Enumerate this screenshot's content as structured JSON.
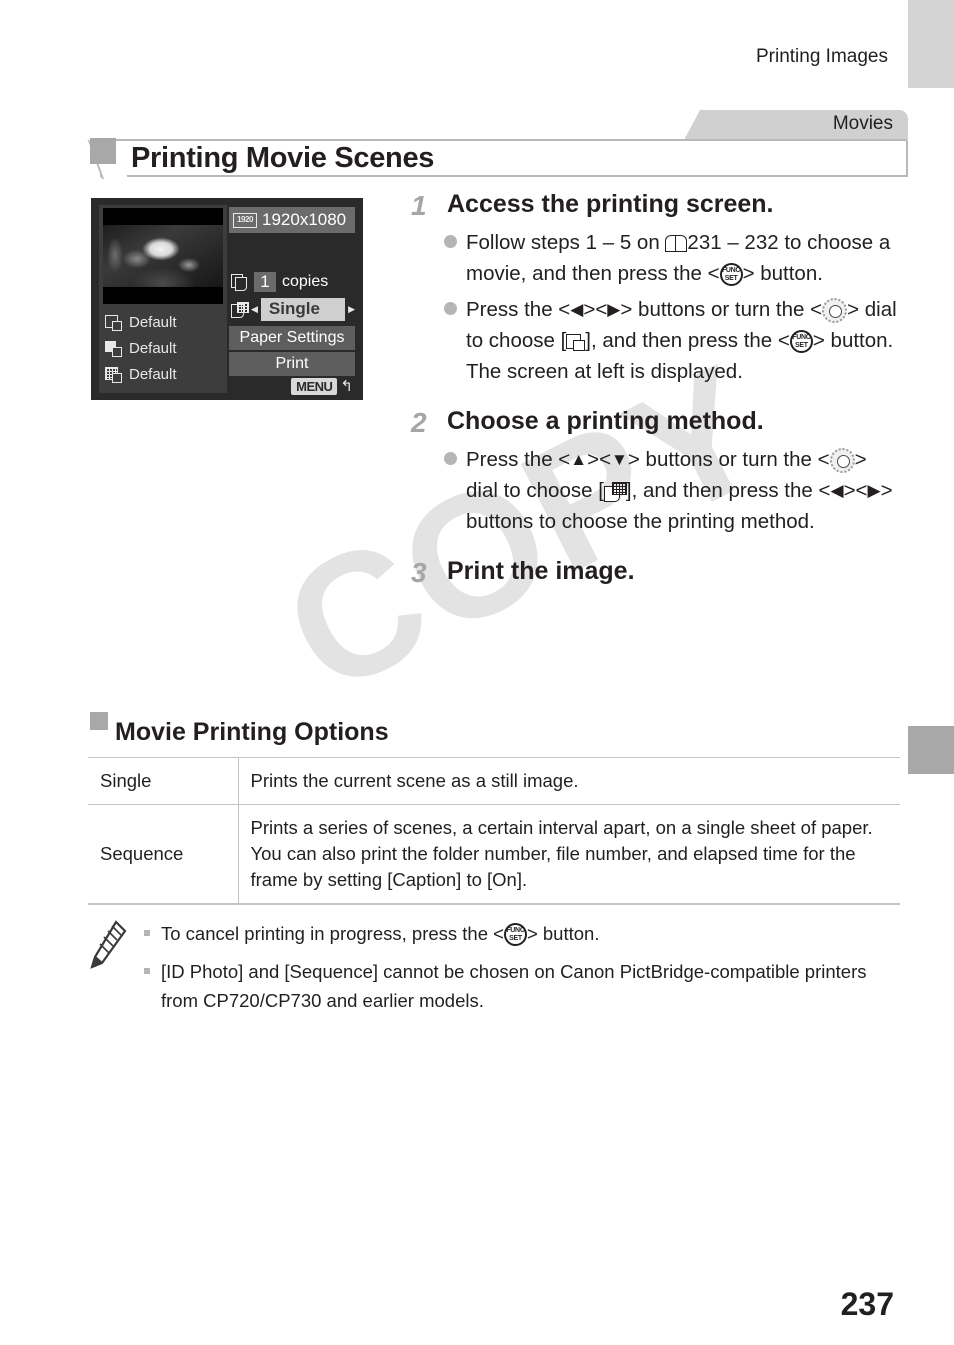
{
  "page": {
    "running_head": "Printing Images",
    "folio": "237",
    "watermark": "COPY"
  },
  "section_tab": {
    "label": "Movies"
  },
  "heading": {
    "title": "Printing Movie Scenes"
  },
  "camera_screen": {
    "resolution_badge": "1920",
    "resolution": "1920x1080",
    "copies_value": "1",
    "copies_label": "copies",
    "method_value": "Single",
    "arrow_left": "◀",
    "arrow_right": "▶",
    "paper_settings": "Paper Settings",
    "print": "Print",
    "menu_chip": "MENU",
    "menu_return": "↰",
    "defaults": [
      {
        "icon": "paper-size-icon",
        "label": "Default"
      },
      {
        "icon": "border-icon",
        "label": "Default"
      },
      {
        "icon": "date-layout-icon",
        "label": "Default"
      }
    ]
  },
  "steps": [
    {
      "num": "1",
      "title": "Access the printing screen.",
      "bullets": [
        {
          "parts": [
            {
              "t": "text",
              "v": "Follow steps 1 – 5 on "
            },
            {
              "t": "icon",
              "v": "book-icon"
            },
            {
              "t": "text",
              "v": "231 – 232 to choose a movie, and then press the <"
            },
            {
              "t": "icon",
              "v": "func-set-icon"
            },
            {
              "t": "text",
              "v": "> button."
            }
          ]
        },
        {
          "parts": [
            {
              "t": "text",
              "v": "Press the <"
            },
            {
              "t": "icon",
              "v": "left-arrow-icon"
            },
            {
              "t": "text",
              "v": "><"
            },
            {
              "t": "icon",
              "v": "right-arrow-icon"
            },
            {
              "t": "text",
              "v": "> buttons or turn the <"
            },
            {
              "t": "icon",
              "v": "control-dial-icon"
            },
            {
              "t": "text",
              "v": "> dial to choose ["
            },
            {
              "t": "icon",
              "v": "print-icon"
            },
            {
              "t": "text",
              "v": "], and then press the <"
            },
            {
              "t": "icon",
              "v": "func-set-icon"
            },
            {
              "t": "text",
              "v": "> button. The screen at left is displayed."
            }
          ]
        }
      ]
    },
    {
      "num": "2",
      "title": "Choose a printing method.",
      "bullets": [
        {
          "parts": [
            {
              "t": "text",
              "v": "Press the <"
            },
            {
              "t": "icon",
              "v": "up-arrow-icon"
            },
            {
              "t": "text",
              "v": "><"
            },
            {
              "t": "icon",
              "v": "down-arrow-icon"
            },
            {
              "t": "text",
              "v": "> buttons or turn the <"
            },
            {
              "t": "icon",
              "v": "control-dial-icon"
            },
            {
              "t": "text",
              "v": "> dial to choose ["
            },
            {
              "t": "icon",
              "v": "sequence-icon"
            },
            {
              "t": "text",
              "v": "], and then press the <"
            },
            {
              "t": "icon",
              "v": "left-arrow-icon"
            },
            {
              "t": "text",
              "v": "><"
            },
            {
              "t": "icon",
              "v": "right-arrow-icon"
            },
            {
              "t": "text",
              "v": "> buttons to choose the printing method."
            }
          ]
        }
      ]
    },
    {
      "num": "3",
      "title": "Print the image.",
      "bullets": []
    }
  ],
  "subheading": {
    "title": "Movie Printing Options"
  },
  "options_table": {
    "rows": [
      {
        "name": "Single",
        "description": "Prints the current scene as a still image."
      },
      {
        "name": "Sequence",
        "description": "Prints a series of scenes, a certain interval apart, on a single sheet of paper. You can also print the folder number, file number, and elapsed time for the frame by setting [Caption] to [On]."
      }
    ]
  },
  "notes": {
    "icon": "pencil-icon",
    "items": [
      {
        "parts": [
          {
            "t": "text",
            "v": "To cancel printing in progress, press the <"
          },
          {
            "t": "icon",
            "v": "func-set-icon"
          },
          {
            "t": "text",
            "v": "> button."
          }
        ]
      },
      {
        "parts": [
          {
            "t": "text",
            "v": "[ID Photo] and [Sequence] cannot be chosen on Canon PictBridge-compatible printers from CP720/CP730 and earlier models."
          }
        ]
      }
    ]
  },
  "colors": {
    "tab_light": "#d4d4d4",
    "tab_dark": "#a8a8a8",
    "rule": "#c4c4c4",
    "step_number": "#a6a6a6",
    "watermark": "#e3e3e3"
  }
}
